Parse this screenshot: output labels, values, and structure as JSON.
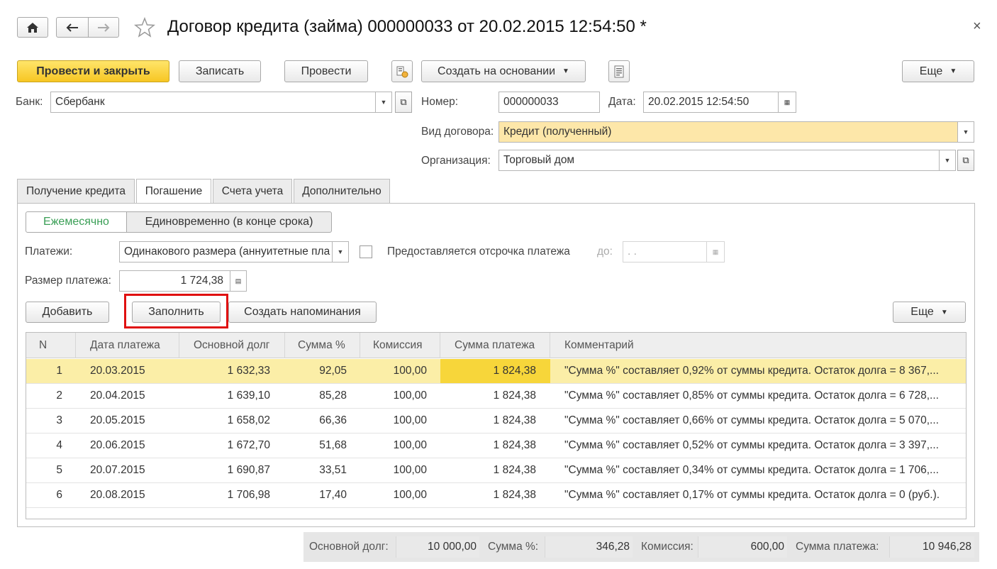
{
  "window": {
    "title": "Договор кредита (займа) 000000033 от 20.02.2015 12:54:50 *",
    "close": "×"
  },
  "toolbar": {
    "post_close": "Провести и закрыть",
    "write": "Записать",
    "post": "Провести",
    "create_based": "Создать на основании",
    "more": "Еще"
  },
  "header": {
    "bank_label": "Банк:",
    "bank_value": "Сбербанк",
    "number_label": "Номер:",
    "number_value": "000000033",
    "date_label": "Дата:",
    "date_value": "20.02.2015 12:54:50",
    "contract_type_label": "Вид договора:",
    "contract_type_value": "Кредит (полученный)",
    "organization_label": "Организация:",
    "organization_value": "Торговый дом"
  },
  "tabs": [
    {
      "label": "Получение кредита"
    },
    {
      "label": "Погашение"
    },
    {
      "label": "Счета учета"
    },
    {
      "label": "Дополнительно"
    }
  ],
  "repayment": {
    "mode_monthly": "Ежемесячно",
    "mode_once": "Единовременно (в конце срока)",
    "payments_label": "Платежи:",
    "payments_value": "Одинакового размера (аннуитетные пла",
    "deferral_label": "Предоставляется отсрочка платежа",
    "until_label": "до:",
    "until_value": " .  .",
    "payment_size_label": "Размер платежа:",
    "payment_size_value": "1 724,38"
  },
  "table_toolbar": {
    "add": "Добавить",
    "fill": "Заполнить",
    "create_reminders": "Создать напоминания",
    "more": "Еще"
  },
  "table": {
    "columns": [
      "N",
      "Дата платежа",
      "Основной долг",
      "Сумма %",
      "Комиссия",
      "Сумма платежа",
      "Комментарий"
    ],
    "rows": [
      {
        "n": "1",
        "date": "20.03.2015",
        "principal": "1 632,33",
        "interest": "92,05",
        "commission": "100,00",
        "payment": "1 824,38",
        "comment": "\"Сумма %\" составляет 0,92% от суммы кредита. Остаток долга = 8 367,..."
      },
      {
        "n": "2",
        "date": "20.04.2015",
        "principal": "1 639,10",
        "interest": "85,28",
        "commission": "100,00",
        "payment": "1 824,38",
        "comment": "\"Сумма %\" составляет 0,85% от суммы кредита. Остаток долга = 6 728,..."
      },
      {
        "n": "3",
        "date": "20.05.2015",
        "principal": "1 658,02",
        "interest": "66,36",
        "commission": "100,00",
        "payment": "1 824,38",
        "comment": "\"Сумма %\" составляет 0,66% от суммы кредита. Остаток долга = 5 070,..."
      },
      {
        "n": "4",
        "date": "20.06.2015",
        "principal": "1 672,70",
        "interest": "51,68",
        "commission": "100,00",
        "payment": "1 824,38",
        "comment": "\"Сумма %\" составляет 0,52% от суммы кредита. Остаток долга = 3 397,..."
      },
      {
        "n": "5",
        "date": "20.07.2015",
        "principal": "1 690,87",
        "interest": "33,51",
        "commission": "100,00",
        "payment": "1 824,38",
        "comment": "\"Сумма %\" составляет 0,34% от суммы кредита. Остаток долга = 1 706,..."
      },
      {
        "n": "6",
        "date": "20.08.2015",
        "principal": "1 706,98",
        "interest": "17,40",
        "commission": "100,00",
        "payment": "1 824,38",
        "comment": "\"Сумма %\" составляет 0,17% от суммы кредита. Остаток долга = 0 (руб.)."
      }
    ]
  },
  "totals": {
    "principal_label": "Основной долг:",
    "principal_value": "10 000,00",
    "interest_label": "Сумма %:",
    "interest_value": "346,28",
    "commission_label": "Комиссия:",
    "commission_value": "600,00",
    "payment_label": "Сумма платежа:",
    "payment_value": "10 946,28"
  },
  "colors": {
    "primary_button": "#f7c623",
    "selected_row": "#fbeea7",
    "selected_cell": "#f7d63a",
    "mandatory_field": "#fde7a9",
    "highlight_frame": "#e01010",
    "active_mode": "#3a9f56"
  },
  "icons": [
    "home-icon",
    "back-arrow-icon",
    "forward-arrow-icon",
    "star-icon",
    "close-icon",
    "structure-icon",
    "report-icon",
    "calendar-icon",
    "dropdown-icon",
    "open-icon"
  ]
}
